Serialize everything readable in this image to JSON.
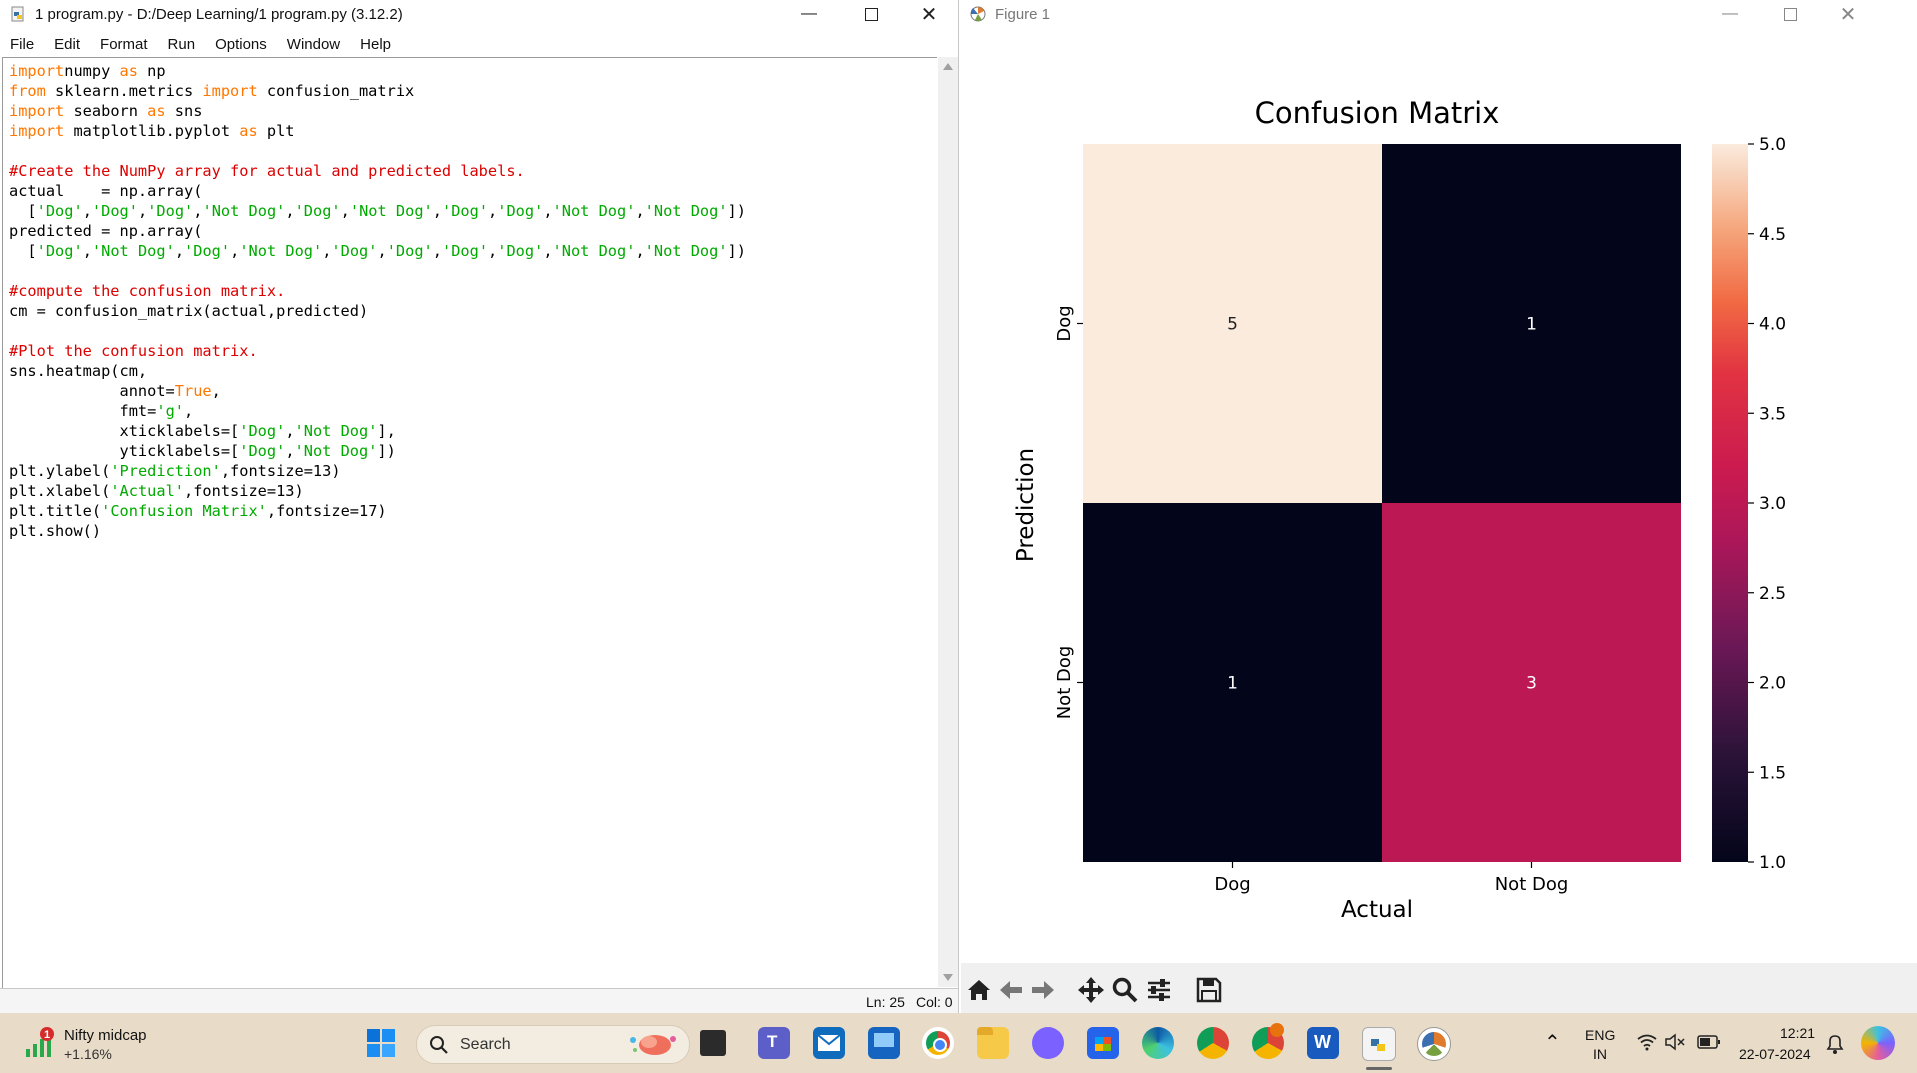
{
  "editor": {
    "title": "1 program.py - D:/Deep Learning/1 program.py (3.12.2)",
    "menu": [
      "File",
      "Edit",
      "Format",
      "Run",
      "Options",
      "Window",
      "Help"
    ],
    "code_lines": [
      [
        [
          "kw",
          "import"
        ],
        [
          "",
          "numpy "
        ],
        [
          "kw",
          "as"
        ],
        [
          "",
          " np"
        ]
      ],
      [
        [
          "kw",
          "from"
        ],
        [
          "",
          " sklearn.metrics "
        ],
        [
          "kw",
          "import"
        ],
        [
          "",
          " confusion_matrix"
        ]
      ],
      [
        [
          "kw",
          "import"
        ],
        [
          "",
          " seaborn "
        ],
        [
          "kw",
          "as"
        ],
        [
          "",
          " sns"
        ]
      ],
      [
        [
          "kw",
          "import"
        ],
        [
          "",
          " matplotlib.pyplot "
        ],
        [
          "kw",
          "as"
        ],
        [
          "",
          " plt"
        ]
      ],
      [],
      [
        [
          "cm",
          "#Create the NumPy array for actual and predicted labels."
        ]
      ],
      [
        [
          "",
          "actual    = np.array("
        ]
      ],
      [
        [
          "",
          "  ["
        ],
        [
          "st",
          "'Dog'"
        ],
        [
          "",
          ","
        ],
        [
          "st",
          "'Dog'"
        ],
        [
          "",
          ","
        ],
        [
          "st",
          "'Dog'"
        ],
        [
          "",
          ","
        ],
        [
          "st",
          "'Not Dog'"
        ],
        [
          "",
          ","
        ],
        [
          "st",
          "'Dog'"
        ],
        [
          "",
          ","
        ],
        [
          "st",
          "'Not Dog'"
        ],
        [
          "",
          ","
        ],
        [
          "st",
          "'Dog'"
        ],
        [
          "",
          ","
        ],
        [
          "st",
          "'Dog'"
        ],
        [
          "",
          ","
        ],
        [
          "st",
          "'Not Dog'"
        ],
        [
          "",
          ","
        ],
        [
          "st",
          "'Not Dog'"
        ],
        [
          "",
          "])"
        ]
      ],
      [
        [
          "",
          "predicted = np.array("
        ]
      ],
      [
        [
          "",
          "  ["
        ],
        [
          "st",
          "'Dog'"
        ],
        [
          "",
          ","
        ],
        [
          "st",
          "'Not Dog'"
        ],
        [
          "",
          ","
        ],
        [
          "st",
          "'Dog'"
        ],
        [
          "",
          ","
        ],
        [
          "st",
          "'Not Dog'"
        ],
        [
          "",
          ","
        ],
        [
          "st",
          "'Dog'"
        ],
        [
          "",
          ","
        ],
        [
          "st",
          "'Dog'"
        ],
        [
          "",
          ","
        ],
        [
          "st",
          "'Dog'"
        ],
        [
          "",
          ","
        ],
        [
          "st",
          "'Dog'"
        ],
        [
          "",
          ","
        ],
        [
          "st",
          "'Not Dog'"
        ],
        [
          "",
          ","
        ],
        [
          "st",
          "'Not Dog'"
        ],
        [
          "",
          "])"
        ]
      ],
      [],
      [
        [
          "cm",
          "#compute the confusion matrix."
        ]
      ],
      [
        [
          "",
          "cm = confusion_matrix(actual,predicted)"
        ]
      ],
      [],
      [
        [
          "cm",
          "#Plot the confusion matrix."
        ]
      ],
      [
        [
          "",
          "sns.heatmap(cm,"
        ]
      ],
      [
        [
          "",
          "            annot="
        ],
        [
          "kw",
          "True"
        ],
        [
          "",
          ","
        ]
      ],
      [
        [
          "",
          "            fmt="
        ],
        [
          "st",
          "'g'"
        ],
        [
          "",
          ","
        ]
      ],
      [
        [
          "",
          "            xticklabels=["
        ],
        [
          "st",
          "'Dog'"
        ],
        [
          "",
          ","
        ],
        [
          "st",
          "'Not Dog'"
        ],
        [
          "",
          "],"
        ]
      ],
      [
        [
          "",
          "            yticklabels=["
        ],
        [
          "st",
          "'Dog'"
        ],
        [
          "",
          ","
        ],
        [
          "st",
          "'Not Dog'"
        ],
        [
          "",
          "])"
        ]
      ],
      [
        [
          "",
          "plt.ylabel("
        ],
        [
          "st",
          "'Prediction'"
        ],
        [
          "",
          ",fontsize=13)"
        ]
      ],
      [
        [
          "",
          "plt.xlabel("
        ],
        [
          "st",
          "'Actual'"
        ],
        [
          "",
          ",fontsize=13)"
        ]
      ],
      [
        [
          "",
          "plt.title("
        ],
        [
          "st",
          "'Confusion Matrix'"
        ],
        [
          "",
          ",fontsize=17)"
        ]
      ],
      [
        [
          "",
          "plt.show()"
        ]
      ]
    ],
    "status": {
      "line": "Ln: 25",
      "col": "Col: 0"
    }
  },
  "figure": {
    "title": "Figure 1",
    "toolbar_icons": [
      "home-icon",
      "back-arrow-icon",
      "forward-arrow-icon",
      "pan-icon",
      "zoom-icon",
      "configure-icon",
      "save-icon"
    ]
  },
  "chart_data": {
    "type": "heatmap",
    "title": "Confusion Matrix",
    "xlabel": "Actual",
    "ylabel": "Prediction",
    "x_categories": [
      "Dog",
      "Not Dog"
    ],
    "y_categories": [
      "Dog",
      "Not Dog"
    ],
    "values": [
      [
        5,
        1
      ],
      [
        1,
        3
      ]
    ],
    "colormap": "rocket",
    "colorbar_range": [
      1.0,
      5.0
    ],
    "colorbar_ticks": [
      "1.0",
      "1.5",
      "2.0",
      "2.5",
      "3.0",
      "3.5",
      "4.0",
      "4.5",
      "5.0"
    ],
    "grid": false
  },
  "taskbar": {
    "widget": {
      "name": "Nifty midcap",
      "change": "+1.16%",
      "badge": "1"
    },
    "search_placeholder": "Search",
    "language": {
      "line1": "ENG",
      "line2": "IN"
    },
    "clock": {
      "time": "12:21",
      "date": "22-07-2024"
    },
    "colors": {
      "background": "#e8dcc8"
    }
  }
}
